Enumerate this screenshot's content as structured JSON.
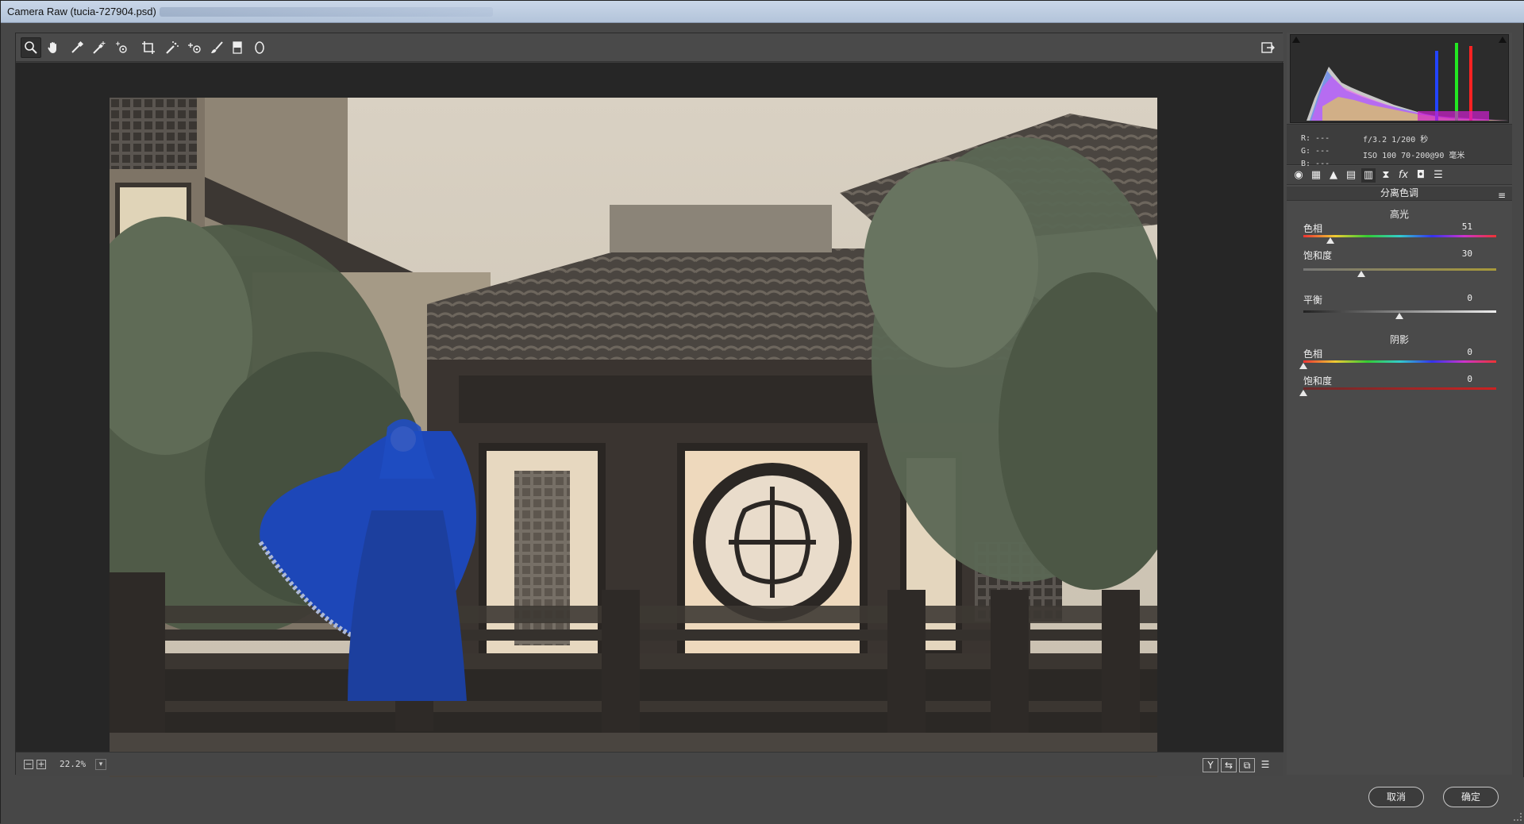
{
  "window": {
    "title": "Camera Raw (tucia-727904.psd)"
  },
  "toolbar": {
    "tools": [
      {
        "name": "zoom-tool",
        "glyph": "magnifier"
      },
      {
        "name": "hand-tool",
        "glyph": "hand"
      },
      {
        "name": "white-balance-tool",
        "glyph": "eyedropper"
      },
      {
        "name": "color-sampler-tool",
        "glyph": "eyedropper-plus"
      },
      {
        "name": "targeted-adjustment-tool",
        "glyph": "target"
      },
      {
        "name": "crop-tool",
        "glyph": "crop"
      },
      {
        "name": "straighten-tool",
        "glyph": "straighten"
      },
      {
        "name": "spot-removal-tool",
        "glyph": "spot"
      },
      {
        "name": "red-eye-tool",
        "glyph": "eye"
      },
      {
        "name": "adjustment-brush-tool",
        "glyph": "brush"
      },
      {
        "name": "graduated-filter-tool",
        "glyph": "gradient"
      },
      {
        "name": "radial-filter-tool",
        "glyph": "ellipse"
      }
    ],
    "export_icon": "open-in-photoshop-icon"
  },
  "status": {
    "zoom_out": "−",
    "zoom_in": "+",
    "zoom_level": "22.2%",
    "view_buttons": [
      "Y",
      "⇆",
      "⧉",
      "☰"
    ]
  },
  "readout": {
    "r": "R:  ---",
    "g": "G:  ---",
    "b": "B:  ---",
    "aperture_shutter": "f/3.2   1/200 秒",
    "iso_lens": "ISO 100   70-200@90 毫米"
  },
  "panel": {
    "title": "分离色调",
    "highlights_label": "高光",
    "shadows_label": "阴影",
    "sliders": {
      "highlight_hue": {
        "label": "色相",
        "value": "51",
        "position": 0.14
      },
      "highlight_saturation": {
        "label": "饱和度",
        "value": "30",
        "position": 0.3
      },
      "balance": {
        "label": "平衡",
        "value": "0",
        "position": 0.5
      },
      "shadow_hue": {
        "label": "色相",
        "value": "0",
        "position": 0.0
      },
      "shadow_saturation": {
        "label": "饱和度",
        "value": "0",
        "position": 0.0
      }
    }
  },
  "footer": {
    "cancel": "取消",
    "ok": "确定"
  },
  "colors": {
    "accent_blue": "#1f4fbf",
    "panel_bg": "#4a4a4a",
    "canvas_bg": "#262626"
  }
}
